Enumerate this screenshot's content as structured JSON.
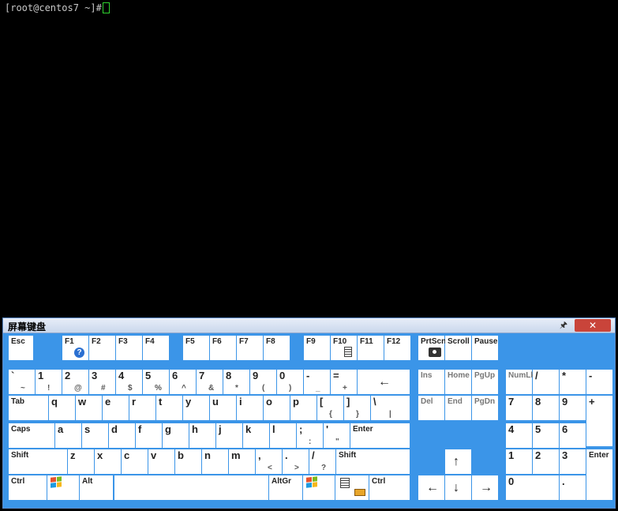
{
  "terminal": {
    "prompt": "[root@centos7 ~]#"
  },
  "osk": {
    "title": "屏幕键盘",
    "pin_icon": "pin-icon",
    "close_label": "✕",
    "colors": {
      "board": "#3b95e8",
      "key": "#ffffff",
      "close": "#c9443a"
    }
  },
  "keys": {
    "esc": "Esc",
    "f1": "F1",
    "f2": "F2",
    "f3": "F3",
    "f4": "F4",
    "f5": "F5",
    "f6": "F6",
    "f7": "F7",
    "f8": "F8",
    "f9": "F9",
    "f10": "F10",
    "f11": "F11",
    "f12": "F12",
    "prtsc": "PrtScn",
    "scroll": "Scroll",
    "pause": "Pause",
    "backtick": "`",
    "tilde": "~",
    "d1": "1",
    "s1": "!",
    "d2": "2",
    "s2": "@",
    "d3": "3",
    "s3": "#",
    "d4": "4",
    "s4": "$",
    "d5": "5",
    "s5": "%",
    "d6": "6",
    "s6": "^",
    "d7": "7",
    "s7": "&",
    "d8": "8",
    "s8": "*",
    "d9": "9",
    "s9": "(",
    "d0": "0",
    "s0": ")",
    "minus": "-",
    "underscore": "_",
    "equals": "=",
    "plus": "+",
    "backspace": "←",
    "ins": "Ins",
    "home": "Home",
    "pgup": "PgUp",
    "numlk": "NumLk",
    "np_div": "/",
    "np_mul": "*",
    "np_sub": "-",
    "tab": "Tab",
    "q": "q",
    "w": "w",
    "e": "e",
    "r": "r",
    "t": "t",
    "y": "y",
    "u": "u",
    "i": "i",
    "o": "o",
    "p": "p",
    "lbracket": "[",
    "lbrace": "{",
    "rbracket": "]",
    "rbrace": "}",
    "backslash": "\\",
    "pipe": "|",
    "del": "Del",
    "end": "End",
    "pgdn": "PgDn",
    "np7": "7",
    "np8": "8",
    "np9": "9",
    "np_add": "+",
    "caps": "Caps",
    "a": "a",
    "s": "s",
    "d": "d",
    "f": "f",
    "g": "g",
    "h": "h",
    "j": "j",
    "k": "k",
    "l": "l",
    "semicolon": ";",
    "colon": ":",
    "quote": "'",
    "dquote": "\"",
    "enter": "Enter",
    "np4": "4",
    "np5": "5",
    "np6": "6",
    "lshift": "Shift",
    "z": "z",
    "x": "x",
    "c": "c",
    "v": "v",
    "b": "b",
    "n": "n",
    "m": "m",
    "comma": ",",
    "lt": "<",
    "period": ".",
    "gt": ">",
    "slash": "/",
    "question": "?",
    "rshift": "Shift",
    "up": "↑",
    "np1": "1",
    "np2": "2",
    "np3": "3",
    "np_enter": "Enter",
    "lctrl": "Ctrl",
    "alt": "Alt",
    "altgr": "AltGr",
    "rctrl": "Ctrl",
    "left": "←",
    "down": "↓",
    "right": "→",
    "np0": "0",
    "np_dot": "."
  }
}
